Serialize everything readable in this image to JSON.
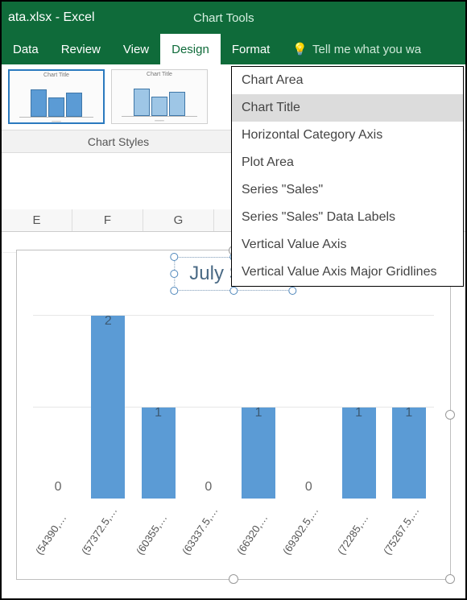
{
  "titlebar": {
    "filename": "ata.xlsx - Excel",
    "chart_tools": "Chart Tools"
  },
  "ribbon": {
    "tabs": [
      "Data",
      "Review",
      "View",
      "Design",
      "Format"
    ],
    "active": "Design",
    "tellme": "Tell me what you wa"
  },
  "gallery": {
    "label": "Chart Styles",
    "thumb_title": "Chart Title"
  },
  "dropdown": {
    "items": [
      "Chart Area",
      "Chart Title",
      "Horizontal Category Axis",
      "Plot Area",
      "Series \"Sales\"",
      "Series \"Sales\" Data Labels",
      "Vertical Value Axis",
      "Vertical Value Axis Major Gridlines"
    ],
    "hovered": "Chart Title"
  },
  "grid": {
    "cols": [
      "E",
      "F",
      "G"
    ]
  },
  "chart": {
    "title": "July Sales"
  },
  "chart_data": {
    "type": "bar",
    "title": "July Sales",
    "categories": [
      "(54390,…",
      "(57372.5,…",
      "(60355,…",
      "(63337.5,…",
      "(66320,…",
      "(69302.5,…",
      "(72285,…",
      "(75267.5,…"
    ],
    "values": [
      0,
      2,
      1,
      0,
      1,
      0,
      1,
      1
    ],
    "xlabel": "",
    "ylabel": "",
    "ylim": [
      0,
      2
    ]
  }
}
